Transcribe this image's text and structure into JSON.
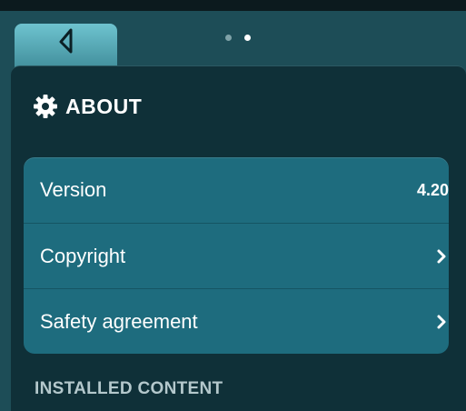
{
  "nav": {
    "back_icon": "back-arrow-icon",
    "pages": 2,
    "current_page": 2
  },
  "header": {
    "icon": "gear-icon",
    "title": "ABOUT"
  },
  "list": {
    "items": [
      {
        "label": "Version",
        "value": "4.20"
      },
      {
        "label": "Copyright",
        "icon": "chevron-right-icon"
      },
      {
        "label": "Safety agreement",
        "icon": "chevron-right-icon"
      }
    ]
  },
  "section": {
    "title": "INSTALLED CONTENT"
  },
  "colors": {
    "background": "#1d4d57",
    "panel": "#0f3038",
    "list_item": "#1e6c7e",
    "tab": "#5aaebb"
  }
}
